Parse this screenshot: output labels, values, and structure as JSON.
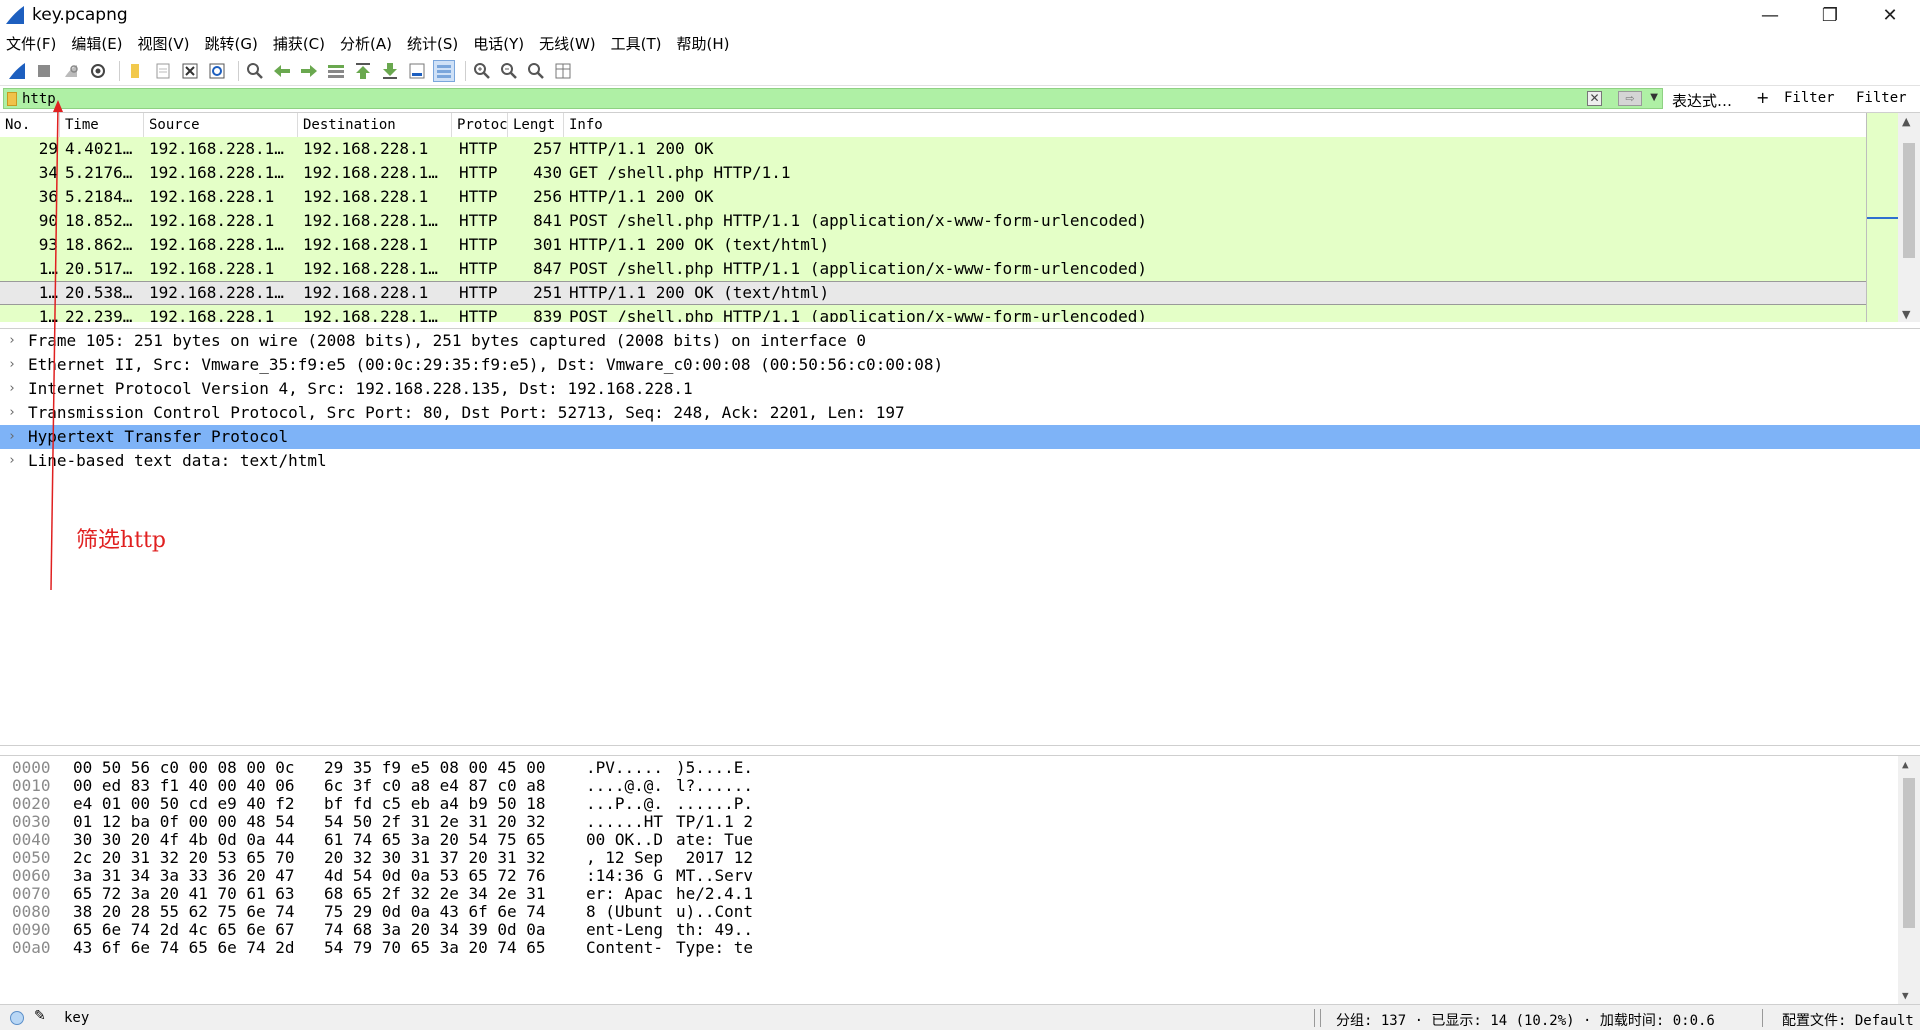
{
  "window": {
    "title": "key.pcapng",
    "minimize": "—",
    "restore": "❐",
    "close": "✕"
  },
  "menu": [
    "文件(F)",
    "编辑(E)",
    "视图(V)",
    "跳转(G)",
    "捕获(C)",
    "分析(A)",
    "统计(S)",
    "电话(Y)",
    "无线(W)",
    "工具(T)",
    "帮助(H)"
  ],
  "toolbar": {
    "icons": [
      "shark-fin-start-icon",
      "stop-capture-icon",
      "restart-capture-icon",
      "capture-options-icon",
      "open-file-icon",
      "save-file-icon",
      "close-file-icon",
      "reload-file-icon",
      "find-packet-icon",
      "go-back-icon",
      "go-forward-icon",
      "go-to-packet-icon",
      "go-first-icon",
      "go-last-icon",
      "auto-scroll-icon",
      "colorize-icon",
      "zoom-in-icon",
      "zoom-out-icon",
      "zoom-normal-icon",
      "resize-columns-icon"
    ]
  },
  "filter": {
    "value": "http",
    "expression_label": "表达式…",
    "plus_label": "+",
    "button1_label": "Filter",
    "button2_label": "Filter",
    "color": "#aff0a5"
  },
  "packet_list": {
    "columns": [
      "No.",
      "Time",
      "Source",
      "Destination",
      "Protoc",
      "Lengt",
      "Info"
    ],
    "rows": [
      {
        "no": "29",
        "time": "4.4021…",
        "src": "192.168.228.1…",
        "dst": "192.168.228.1",
        "proto": "HTTP",
        "len": "257",
        "info": "HTTP/1.1 200 OK",
        "marker": ""
      },
      {
        "no": "34",
        "time": "5.2176…",
        "src": "192.168.228.1…",
        "dst": "192.168.228.1…",
        "proto": "HTTP",
        "len": "430",
        "info": "GET /shell.php HTTP/1.1",
        "marker": ""
      },
      {
        "no": "36",
        "time": "5.2184…",
        "src": "192.168.228.1",
        "dst": "192.168.228.1",
        "proto": "HTTP",
        "len": "256",
        "info": "HTTP/1.1 200 OK",
        "marker": ""
      },
      {
        "no": "90",
        "time": "18.852…",
        "src": "192.168.228.1",
        "dst": "192.168.228.1…",
        "proto": "HTTP",
        "len": "841",
        "info": "POST /shell.php HTTP/1.1  (application/x-www-form-urlencoded)",
        "marker": "┊"
      },
      {
        "no": "93",
        "time": "18.862…",
        "src": "192.168.228.1…",
        "dst": "192.168.228.1",
        "proto": "HTTP",
        "len": "301",
        "info": "HTTP/1.1 200 OK  (text/html)",
        "marker": "┊"
      },
      {
        "no": "1…",
        "time": "20.517…",
        "src": "192.168.228.1",
        "dst": "192.168.228.1…",
        "proto": "HTTP",
        "len": "847",
        "info": "POST /shell.php HTTP/1.1  (application/x-www-form-urlencoded)",
        "marker": "→"
      },
      {
        "no": "1…",
        "time": "20.538…",
        "src": "192.168.228.1…",
        "dst": "192.168.228.1",
        "proto": "HTTP",
        "len": "251",
        "info": "HTTP/1.1 200 OK  (text/html)",
        "marker": "←"
      },
      {
        "no": "1…",
        "time": "22.239…",
        "src": "192.168.228.1",
        "dst": "192.168.228.1…",
        "proto": "HTTP",
        "len": "839",
        "info": "POST /shell.php HTTP/1.1  (application/x-www-form-urlencoded)",
        "marker": ""
      }
    ],
    "selected_index": 6,
    "row_color": "#e4ffc7"
  },
  "details": {
    "rows": [
      "Frame 105: 251 bytes on wire (2008 bits), 251 bytes captured (2008 bits) on interface 0",
      "Ethernet II, Src: Vmware_35:f9:e5 (00:0c:29:35:f9:e5), Dst: Vmware_c0:00:08 (00:50:56:c0:00:08)",
      "Internet Protocol Version 4, Src: 192.168.228.135, Dst: 192.168.228.1",
      "Transmission Control Protocol, Src Port: 80, Dst Port: 52713, Seq: 248, Ack: 2201, Len: 197",
      "Hypertext Transfer Protocol",
      "Line-based text data: text/html"
    ],
    "selected_index": 4,
    "selected_color": "#7eb3f7"
  },
  "bytes": {
    "rows": [
      {
        "off": "0000",
        "hex1": "00 50 56 c0 00 08 00 0c",
        "hex2": "29 35 f9 e5 08 00 45 00",
        "asc1": ".PV.....",
        "asc2": ")5....E."
      },
      {
        "off": "0010",
        "hex1": "00 ed 83 f1 40 00 40 06",
        "hex2": "6c 3f c0 a8 e4 87 c0 a8",
        "asc1": "....@.@.",
        "asc2": "l?......"
      },
      {
        "off": "0020",
        "hex1": "e4 01 00 50 cd e9 40 f2",
        "hex2": "bf fd c5 eb a4 b9 50 18",
        "asc1": "...P..@.",
        "asc2": "......P."
      },
      {
        "off": "0030",
        "hex1": "01 12 ba 0f 00 00 48 54",
        "hex2": "54 50 2f 31 2e 31 20 32",
        "asc1": "......HT",
        "asc2": "TP/1.1 2"
      },
      {
        "off": "0040",
        "hex1": "30 30 20 4f 4b 0d 0a 44",
        "hex2": "61 74 65 3a 20 54 75 65",
        "asc1": "00 OK..D",
        "asc2": "ate: Tue"
      },
      {
        "off": "0050",
        "hex1": "2c 20 31 32 20 53 65 70",
        "hex2": "20 32 30 31 37 20 31 32",
        "asc1": ", 12 Sep",
        "asc2": " 2017 12"
      },
      {
        "off": "0060",
        "hex1": "3a 31 34 3a 33 36 20 47",
        "hex2": "4d 54 0d 0a 53 65 72 76",
        "asc1": ":14:36 G",
        "asc2": "MT..Serv"
      },
      {
        "off": "0070",
        "hex1": "65 72 3a 20 41 70 61 63",
        "hex2": "68 65 2f 32 2e 34 2e 31",
        "asc1": "er: Apac",
        "asc2": "he/2.4.1"
      },
      {
        "off": "0080",
        "hex1": "38 20 28 55 62 75 6e 74",
        "hex2": "75 29 0d 0a 43 6f 6e 74",
        "asc1": "8 (Ubunt",
        "asc2": "u)..Cont"
      },
      {
        "off": "0090",
        "hex1": "65 6e 74 2d 4c 65 6e 67",
        "hex2": "74 68 3a 20 34 39 0d 0a",
        "asc1": "ent-Leng",
        "asc2": "th: 49.."
      },
      {
        "off": "00a0",
        "hex1": "43 6f 6e 74 65 6e 74 2d",
        "hex2": "54 79 70 65 3a 20 74 65",
        "asc1": "Content-",
        "asc2": "Type: te"
      }
    ]
  },
  "status": {
    "file": "key",
    "packets": "分组: 137 · 已显示: 14 (10.2%) · 加载时间: 0:0.6",
    "profile": "配置文件: Default"
  },
  "annotation": {
    "text": "筛选http",
    "color": "#e02020"
  }
}
